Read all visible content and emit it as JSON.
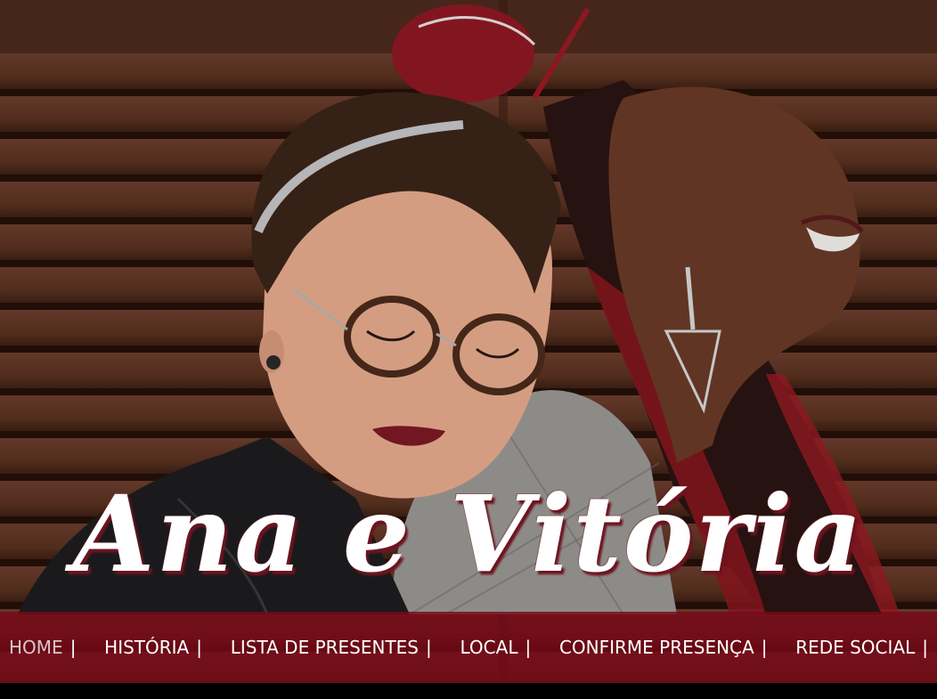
{
  "hero": {
    "title": "Ana e Vitória"
  },
  "nav": {
    "items": [
      {
        "label": "HOME",
        "separator": "|"
      },
      {
        "label": "HISTÓRIA",
        "separator": "|"
      },
      {
        "label": "LISTA DE PRESENTES",
        "separator": "|"
      },
      {
        "label": "LOCAL",
        "separator": "|"
      },
      {
        "label": "CONFIRME PRESENÇA",
        "separator": "|"
      },
      {
        "label": "REDE SOCIAL",
        "separator": "|"
      }
    ]
  },
  "colors": {
    "nav_background": "#78081a",
    "title_text": "#ffffff",
    "title_shadow": "#6e1420",
    "wood": "#5a3326"
  }
}
